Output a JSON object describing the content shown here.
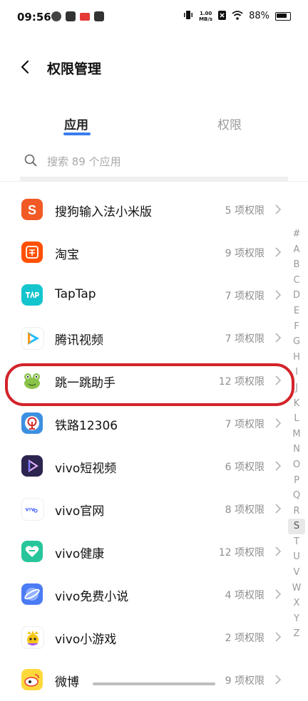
{
  "status_bar": {
    "time": "09:56",
    "speed_value": "1.00",
    "speed_unit": "MB/s",
    "battery": "88%"
  },
  "header": {
    "title": "权限管理"
  },
  "tabs": [
    {
      "label": "应用",
      "active": true
    },
    {
      "label": "权限",
      "active": false
    }
  ],
  "search": {
    "placeholder": "搜索 89 个应用"
  },
  "apps": [
    {
      "name": "搜狗输入法小米版",
      "permissions": "5 项权限",
      "icon": "sogou-icon",
      "color": "#f15a24"
    },
    {
      "name": "淘宝",
      "permissions": "9 项权限",
      "icon": "taobao-icon",
      "color": "#ff5000"
    },
    {
      "name": "TapTap",
      "permissions": "7 项权限",
      "icon": "taptap-icon",
      "color": "#15c5ce"
    },
    {
      "name": "腾讯视频",
      "permissions": "7 项权限",
      "icon": "tencent-video-icon",
      "color": "#ffffff"
    },
    {
      "name": "跳一跳助手",
      "permissions": "12 项权限",
      "icon": "frog-icon",
      "color": "#ffffff"
    },
    {
      "name": "铁路12306",
      "permissions": "7 项权限",
      "icon": "railway-icon",
      "color": "#3d8fe0"
    },
    {
      "name": "vivo短视频",
      "permissions": "6 项权限",
      "icon": "vivo-video-icon",
      "color": "#2c2550"
    },
    {
      "name": "vivo官网",
      "permissions": "8 项权限",
      "icon": "vivo-official-icon",
      "color": "#ffffff"
    },
    {
      "name": "vivo健康",
      "permissions": "12 项权限",
      "icon": "vivo-health-icon",
      "color": "#27c59a"
    },
    {
      "name": "vivo免费小说",
      "permissions": "4 项权限",
      "icon": "vivo-novel-icon",
      "color": "#4b7bf5"
    },
    {
      "name": "vivo小游戏",
      "permissions": "2 项权限",
      "icon": "vivo-games-icon",
      "color": "#ffffff"
    },
    {
      "name": "微博",
      "permissions": "9 项权限",
      "icon": "weibo-icon",
      "color": "#ffd93b"
    }
  ],
  "alpha_index": [
    "#",
    "A",
    "B",
    "C",
    "D",
    "E",
    "F",
    "G",
    "H",
    "I",
    "J",
    "K",
    "L",
    "M",
    "N",
    "O",
    "P",
    "Q",
    "R",
    "S",
    "T",
    "U",
    "V",
    "W",
    "X",
    "Y",
    "Z"
  ],
  "alpha_selected": "S"
}
